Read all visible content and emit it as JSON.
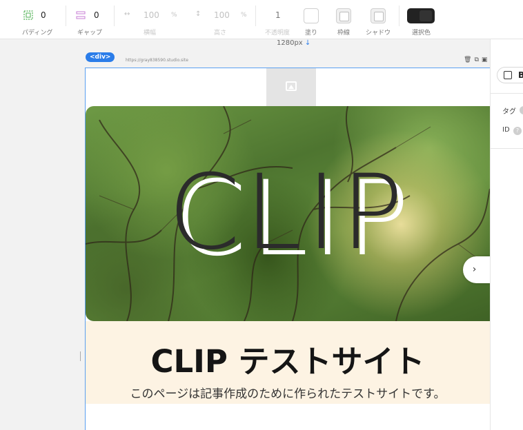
{
  "toolbar": {
    "padding": {
      "value": "0",
      "label": "パディング"
    },
    "gap": {
      "value": "0",
      "label": "ギャップ"
    },
    "width": {
      "value": "100",
      "unit": "%",
      "label": "横幅"
    },
    "height": {
      "value": "100",
      "unit": "%",
      "label": "高さ"
    },
    "opacity": {
      "value": "1",
      "label": "不透明度"
    },
    "fill": {
      "label": "塗り"
    },
    "border": {
      "label": "枠線"
    },
    "shadow": {
      "label": "シャドウ"
    },
    "selected_color": {
      "label": "選択色",
      "color": "#222222"
    }
  },
  "canvas": {
    "width_indicator": "1280px",
    "frame_tag": "<div>",
    "url": "https://gray838590.studio.site"
  },
  "hero": {
    "title": "CLIP",
    "next_icon": "chevron-right-icon"
  },
  "site": {
    "title": "CLIP テストサイト",
    "subtitle": "このページは記事作成のために作られたテストサイトです。"
  },
  "right_panel": {
    "button_label": "B",
    "tag_label": "タグ",
    "id_label": "ID",
    "help_glyph": "?"
  },
  "colors": {
    "accent": "#2b7de9",
    "caption_bg": "#fdf3e3"
  }
}
